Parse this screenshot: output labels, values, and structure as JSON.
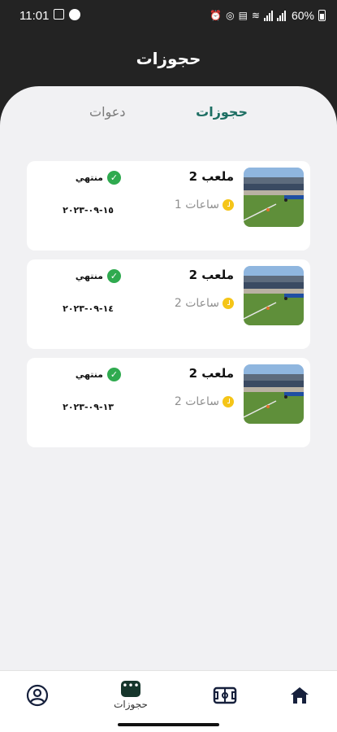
{
  "status_bar": {
    "time": "11:01",
    "battery": "60%"
  },
  "header": {
    "title": "حجوزات"
  },
  "tabs": [
    {
      "label": "حجوزات",
      "active": true
    },
    {
      "label": "دعوات",
      "active": false
    }
  ],
  "bookings": [
    {
      "venue": "ملعب 2",
      "duration": "1 ساعات",
      "status": "منتهي",
      "date": "١٥-٠٩-٢٠٢٣"
    },
    {
      "venue": "ملعب 2",
      "duration": "2 ساعات",
      "status": "منتهي",
      "date": "١٤-٠٩-٢٠٢٣"
    },
    {
      "venue": "ملعب 2",
      "duration": "2 ساعات",
      "status": "منتهي",
      "date": "١٣-٠٩-٢٠٢٣"
    }
  ],
  "bottom_nav": {
    "items": [
      {
        "icon": "home-icon"
      },
      {
        "icon": "field-icon"
      },
      {
        "icon": "bookings-icon",
        "label": "حجوزات",
        "active": true
      },
      {
        "icon": "profile-icon"
      }
    ]
  },
  "colors": {
    "accent": "#1e6f63",
    "header_bg": "#232323",
    "success": "#2faa4f",
    "clock": "#f5c518",
    "nav_dark": "#16362c"
  }
}
